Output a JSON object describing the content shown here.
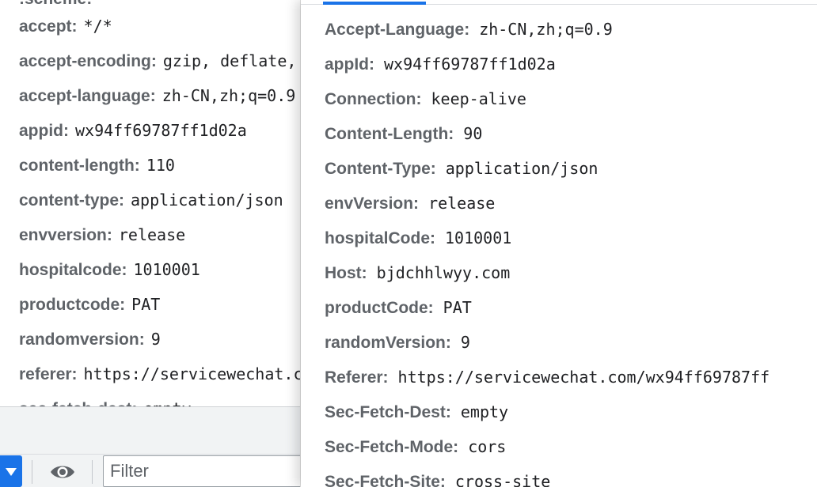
{
  "left_pane": {
    "headers": [
      {
        "name": "accept:",
        "value": "*/*"
      },
      {
        "name": "accept-encoding:",
        "value": "gzip, deflate, br"
      },
      {
        "name": "accept-language:",
        "value": "zh-CN,zh;q=0.9"
      },
      {
        "name": "appid:",
        "value": "wx94ff69787ff1d02a"
      },
      {
        "name": "content-length:",
        "value": "110"
      },
      {
        "name": "content-type:",
        "value": "application/json"
      },
      {
        "name": "envversion:",
        "value": "release"
      },
      {
        "name": "hospitalcode:",
        "value": "1010001"
      },
      {
        "name": "productcode:",
        "value": "PAT"
      },
      {
        "name": "randomversion:",
        "value": "9"
      },
      {
        "name": "referer:",
        "value": "https://servicewechat.com/"
      },
      {
        "name": "sec-fetch-dest:",
        "value": "empty"
      }
    ]
  },
  "toolbar": {
    "filter_placeholder": "Filter",
    "accent_color": "#1a73e8"
  },
  "right_pane": {
    "headers": [
      {
        "name": "Accept-Language:",
        "value": "zh-CN,zh;q=0.9"
      },
      {
        "name": "appId:",
        "value": "wx94ff69787ff1d02a"
      },
      {
        "name": "Connection:",
        "value": "keep-alive"
      },
      {
        "name": "Content-Length:",
        "value": "90"
      },
      {
        "name": "Content-Type:",
        "value": "application/json"
      },
      {
        "name": "envVersion:",
        "value": "release"
      },
      {
        "name": "hospitalCode:",
        "value": "1010001"
      },
      {
        "name": "Host:",
        "value": "bjdchhlwyy.com"
      },
      {
        "name": "productCode:",
        "value": "PAT"
      },
      {
        "name": "randomVersion:",
        "value": "9"
      },
      {
        "name": "Referer:",
        "value": "https://servicewechat.com/wx94ff69787ff"
      },
      {
        "name": "Sec-Fetch-Dest:",
        "value": "empty"
      },
      {
        "name": "Sec-Fetch-Mode:",
        "value": "cors"
      },
      {
        "name": "Sec-Fetch-Site:",
        "value": "cross-site"
      }
    ]
  }
}
